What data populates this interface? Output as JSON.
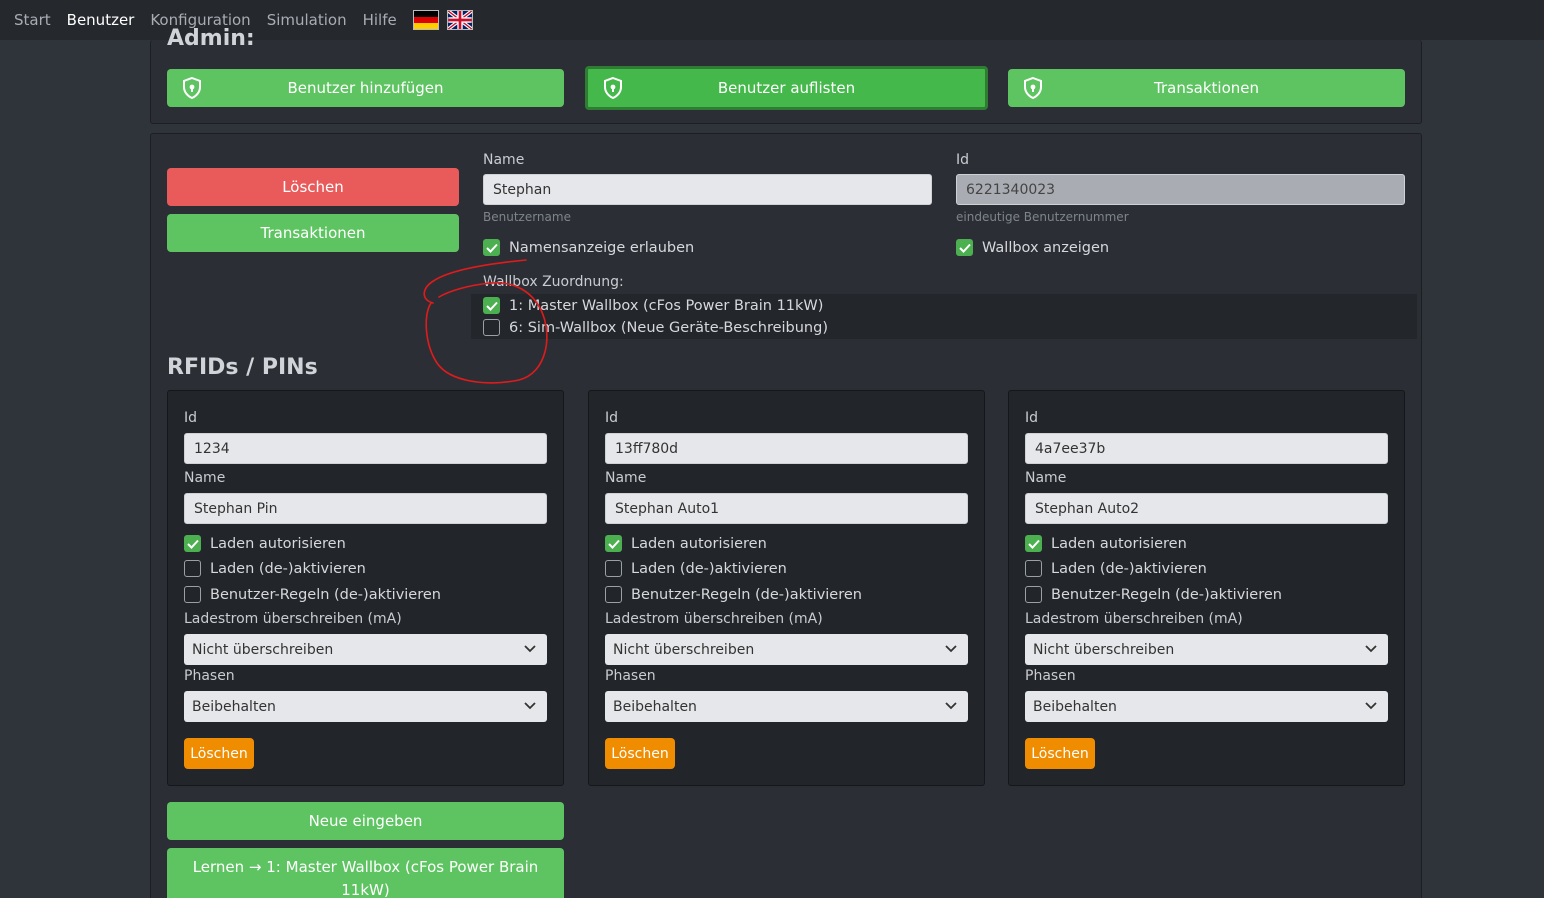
{
  "nav": {
    "items": [
      {
        "label": "Start"
      },
      {
        "label": "Benutzer"
      },
      {
        "label": "Konfiguration"
      },
      {
        "label": "Simulation"
      },
      {
        "label": "Hilfe"
      }
    ],
    "active_color": "#ffffff"
  },
  "admin": {
    "heading": "Admin:",
    "buttons": {
      "add_user": "Benutzer hinzufügen",
      "list_users": "Benutzer auflisten",
      "transactions": "Transaktionen"
    }
  },
  "user": {
    "delete_label": "Löschen",
    "transactions_label": "Transaktionen",
    "name_label": "Name",
    "name_value": "Stephan",
    "name_hint": "Benutzername",
    "id_label": "Id",
    "id_value": "6221340023",
    "id_hint": "eindeutige Benutzernummer",
    "allow_name_display": "Namensanzeige erlauben",
    "show_wallbox": "Wallbox anzeigen",
    "wallbox_assignment_label": "Wallbox Zuordnung:",
    "wallboxes": [
      {
        "label": "1: Master Wallbox (cFos Power Brain 11kW)",
        "checked": true
      },
      {
        "label": "6: Sim-Wallbox (Neue Geräte-Beschreibung)",
        "checked": false
      }
    ]
  },
  "rfids": {
    "heading": "RFIDs / PINs",
    "labels": {
      "id": "Id",
      "name": "Name",
      "authorize": "Laden autorisieren",
      "toggle_charging": "Laden (de-)aktivieren",
      "toggle_rules": "Benutzer-Regeln (de-)aktivieren",
      "current_override": "Ladestrom überschreiben (mA)",
      "phases": "Phasen",
      "delete": "Löschen"
    },
    "cards": [
      {
        "id": "1234",
        "name": "Stephan Pin",
        "authorize": true,
        "toggle_charging": false,
        "toggle_rules": false,
        "current_override": "Nicht überschreiben",
        "phases": "Beibehalten"
      },
      {
        "id": "13ff780d",
        "name": "Stephan Auto1",
        "authorize": true,
        "toggle_charging": false,
        "toggle_rules": false,
        "current_override": "Nicht überschreiben",
        "phases": "Beibehalten"
      },
      {
        "id": "4a7ee37b",
        "name": "Stephan Auto2",
        "authorize": true,
        "toggle_charging": false,
        "toggle_rules": false,
        "current_override": "Nicht überschreiben",
        "phases": "Beibehalten"
      }
    ],
    "new_entry": "Neue eingeben",
    "learn_line1": "Lernen → 1: Master Wallbox (cFos Power Brain",
    "learn_line2": "11kW)"
  },
  "colors": {
    "green": "#5ec462",
    "red": "#e95b5b",
    "orange": "#f08c00",
    "annotation": "#e01b1b"
  }
}
